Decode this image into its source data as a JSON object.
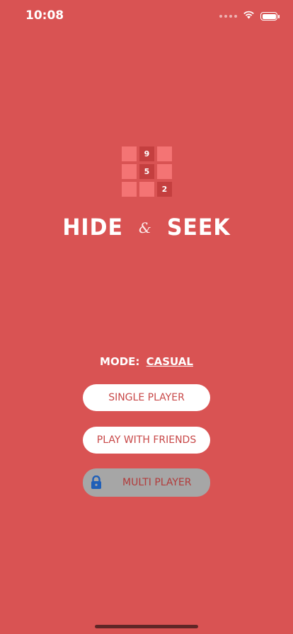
{
  "status_bar": {
    "time": "10:08"
  },
  "logo": {
    "cells": [
      "",
      "9",
      "",
      "",
      "5",
      "",
      "",
      "",
      "2"
    ]
  },
  "title": {
    "left": "HIDE",
    "amp": "&",
    "right": "SEEK"
  },
  "mode": {
    "label": "MODE:",
    "value": "CASUAL"
  },
  "buttons": {
    "single_player": "SINGLE PLAYER",
    "play_with_friends": "PLAY WITH FRIENDS",
    "multi_player": "MULTI PLAYER"
  },
  "colors": {
    "background": "#d95353",
    "tile_light": "#f47474",
    "tile_dark": "#c43f3f",
    "button_text": "#c84848",
    "locked_button": "#a6a6a6",
    "lock_icon": "#1f5fb8"
  },
  "icons": {
    "lock": "lock-icon",
    "wifi": "wifi-icon",
    "battery": "battery-icon",
    "signal": "signal-icon"
  }
}
